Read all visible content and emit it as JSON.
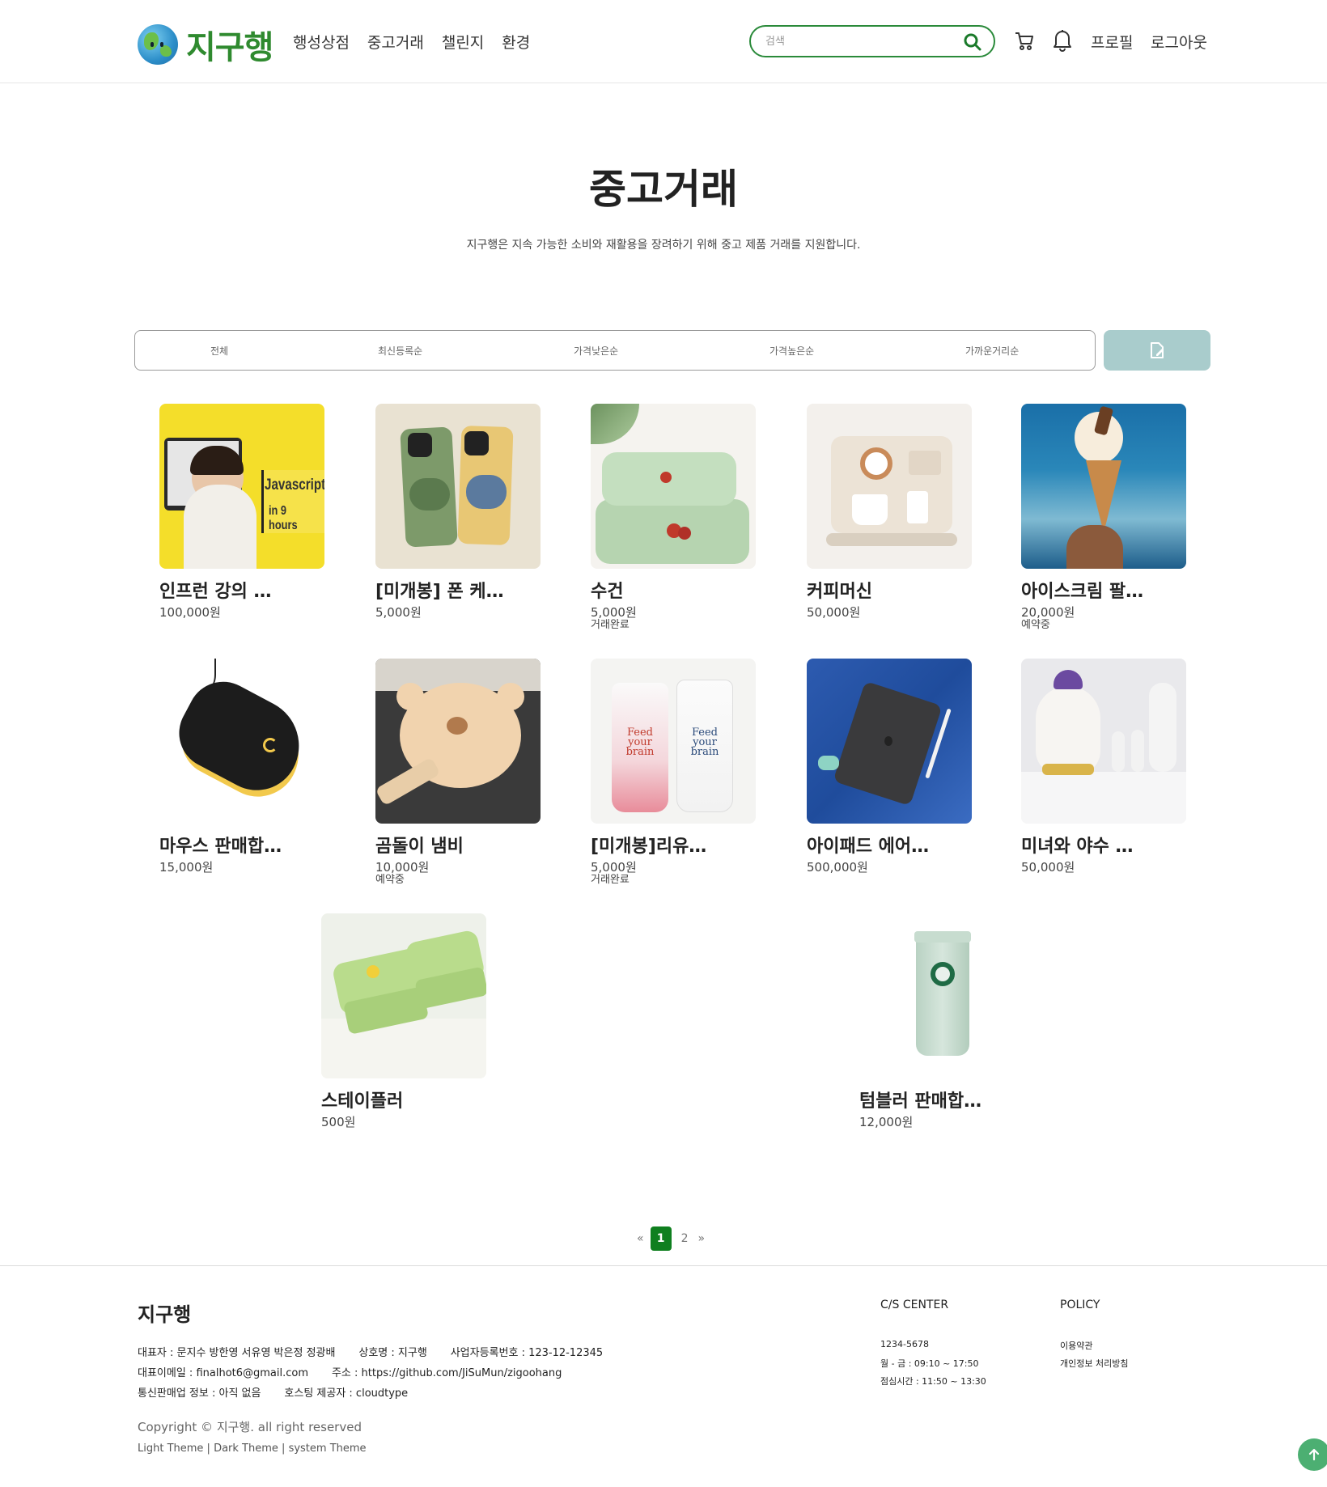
{
  "header": {
    "logo_text": "지구행",
    "nav": [
      "행성상점",
      "중고거래",
      "챌린지",
      "환경"
    ],
    "search_placeholder": "검색",
    "profile": "프로필",
    "logout": "로그아웃"
  },
  "hero": {
    "title": "중고거래",
    "description": "지구행은 지속 가능한 소비와 재활용을 장려하기 위해 중고 제품 거래를 지원합니다."
  },
  "sort": [
    "전체",
    "최신등록순",
    "가격낮은순",
    "가격높은순",
    "가까운거리순"
  ],
  "products": [
    {
      "name": "인프런 강의 …",
      "price": "100,000원",
      "status": ""
    },
    {
      "name": "[미개봉] 폰 케…",
      "price": "5,000원",
      "status": ""
    },
    {
      "name": "수건",
      "price": "5,000원",
      "status": "거래완료"
    },
    {
      "name": "커피머신",
      "price": "50,000원",
      "status": ""
    },
    {
      "name": "아이스크림 팔…",
      "price": "20,000원",
      "status": "예약중"
    },
    {
      "name": "마우스 판매합…",
      "price": "15,000원",
      "status": ""
    },
    {
      "name": "곰돌이 냄비",
      "price": "10,000원",
      "status": "예약중"
    },
    {
      "name": "[미개봉]리유…",
      "price": "5,000원",
      "status": "거래완료"
    },
    {
      "name": "아이패드 에어…",
      "price": "500,000원",
      "status": ""
    },
    {
      "name": "미녀와 야수 …",
      "price": "50,000원",
      "status": ""
    },
    {
      "name": "스테이플러",
      "price": "500원",
      "status": ""
    },
    {
      "name": "텀블러 판매합…",
      "price": "12,000원",
      "status": ""
    }
  ],
  "image_texts": {
    "lecture_line1": "Javascript",
    "lecture_line2": "in 9 hours",
    "cup_text": "Feed your brain"
  },
  "pagination": {
    "prev": "«",
    "pages": [
      "1",
      "2"
    ],
    "current": "1",
    "next": "»"
  },
  "footer": {
    "brand": "지구행",
    "info_line1": "대표자 : 문지수 방한영 서유영 박은정 정광배       상호명 : 지구행       사업자등록번호 : 123-12-12345",
    "info_line2": "대표이메일 : finalhot6@gmail.com       주소 : https://github.com/JiSuMun/zigoohang",
    "info_line3": "통신판매업 정보 : 아직 없음       호스팅 제공자 : cloudtype",
    "copyright": "Copyright © 지구행. all right reserved",
    "themes": [
      "Light Theme",
      "Dark Theme",
      "system Theme"
    ],
    "theme_sep": " | ",
    "cs_title": "C/S CENTER",
    "cs_items": [
      "1234-5678",
      "월 - 금 : 09:10 ~ 17:50",
      "점심시간 : 11:50 ~ 13:30"
    ],
    "policy_title": "POLICY",
    "policy_items": [
      "이용약관",
      "개인정보 처리방침"
    ]
  },
  "colors": {
    "accent": "#0f7f1f",
    "write_button": "#a9cccc",
    "search_border": "#2a8a3a"
  }
}
